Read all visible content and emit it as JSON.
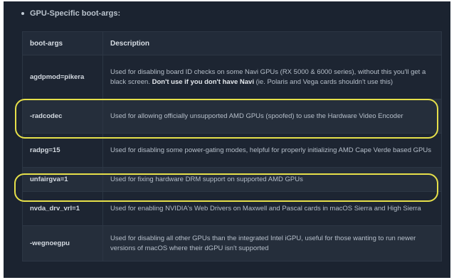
{
  "section": {
    "heading": "GPU-Specific boot-args:"
  },
  "table": {
    "headers": {
      "arg": "boot-args",
      "description": "Description"
    },
    "rows": [
      {
        "arg": "agdpmod=pikera",
        "description_start": "Used for disabling board ID checks on some Navi GPUs (RX 5000 & 6000 series), without this you'll get a black screen.",
        "description_bold": "Don't use if you don't have Navi",
        "description_end": "(ie. Polaris and Vega cards shouldn't use this)"
      },
      {
        "arg": "-radcodec",
        "description": "Used for allowing officially unsupported AMD GPUs (spoofed) to use the Hardware Video Encoder"
      },
      {
        "arg": "radpg=15",
        "description": "Used for disabling some power-gating modes, helpful for properly initializing AMD Cape Verde based GPUs"
      },
      {
        "arg": "unfairgva=1",
        "description": "Used for fixing hardware DRM support on supported AMD GPUs"
      },
      {
        "arg": "nvda_drv_vrl=1",
        "description": "Used for enabling NVIDIA's Web Drivers on Maxwell and Pascal cards in macOS Sierra and High Sierra"
      },
      {
        "arg": "-wegnoegpu",
        "description": "Used for disabling all other GPUs than the integrated Intel iGPU, useful for those wanting to run newer versions of macOS where their dGPU isn't supported"
      }
    ]
  },
  "colors": {
    "background": "#1b2330",
    "highlight": "#e6e04a",
    "text": "#b6bfca"
  }
}
